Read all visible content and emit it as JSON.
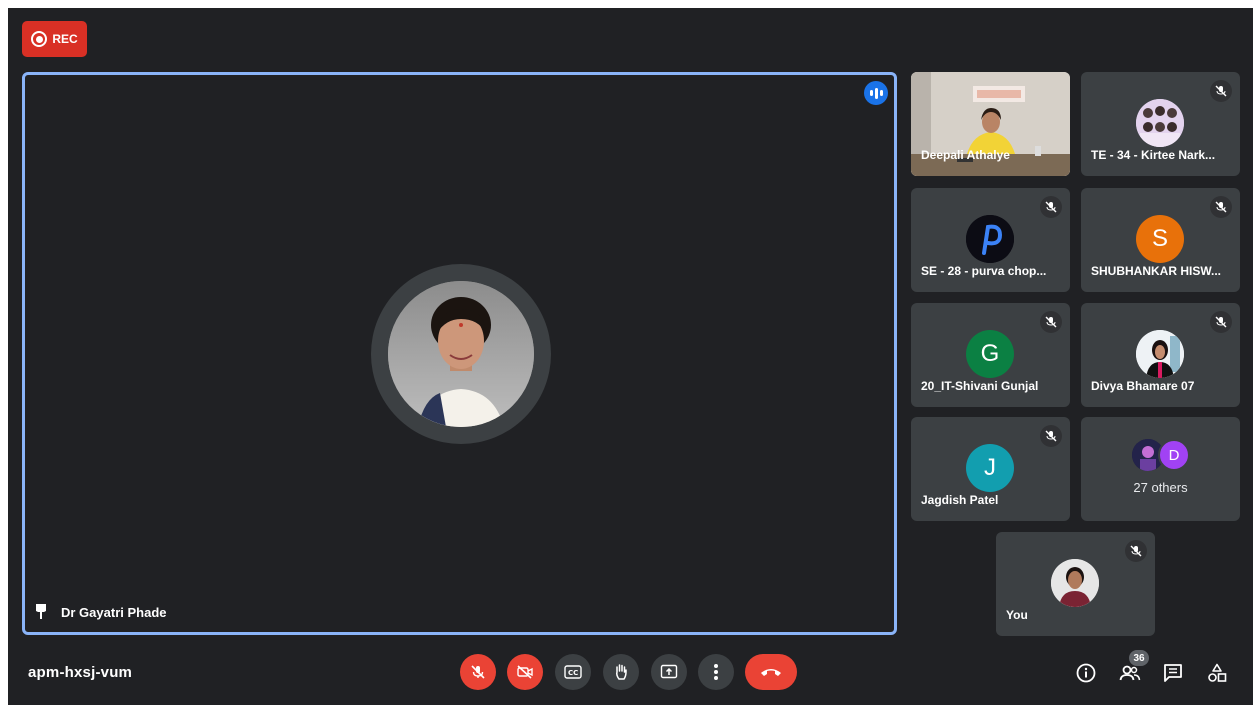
{
  "recording": {
    "label": "REC"
  },
  "main_speaker": {
    "name": "Dr Gayatri Phade"
  },
  "participants": [
    {
      "name": "Deepali Athalye",
      "type": "video"
    },
    {
      "name": "TE - 34 - Kirtee Nark...",
      "type": "photo",
      "muted": true
    },
    {
      "name": "SE - 28 - purva chop...",
      "type": "photo",
      "muted": true
    },
    {
      "name": "SHUBHANKAR HISW...",
      "type": "initial",
      "initial": "S",
      "color": "#e8710a",
      "muted": true
    },
    {
      "name": "20_IT-Shivani Gunjal",
      "type": "initial",
      "initial": "G",
      "color": "#0b8043",
      "muted": true
    },
    {
      "name": "Divya Bhamare 07",
      "type": "photo",
      "muted": true
    },
    {
      "name": "Jagdish Patel",
      "type": "initial",
      "initial": "J",
      "color": "#129eaf",
      "muted": true
    }
  ],
  "others": {
    "label": "27 others",
    "initial": "D",
    "color": "#a142f4"
  },
  "self": {
    "name": "You",
    "muted": true
  },
  "bottom_bar": {
    "meeting_code": "apm-hxsj-vum",
    "participant_count": "36"
  },
  "colors": {
    "background": "#202124",
    "tile": "#3c4043",
    "danger": "#ea4335",
    "active_speaker": "#8ab4f8"
  },
  "icons": {
    "controls": [
      "mic-off-icon",
      "camera-off-icon",
      "captions-icon",
      "raise-hand-icon",
      "present-icon",
      "more-options-icon",
      "end-call-icon"
    ],
    "right": [
      "info-icon",
      "people-icon",
      "chat-icon",
      "activities-icon"
    ]
  }
}
